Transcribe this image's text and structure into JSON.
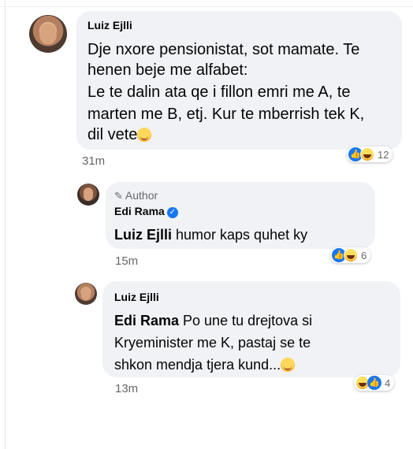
{
  "comment1": {
    "author": "Luiz Ejlli",
    "lines": [
      "Dje nxore pensionistat, sot mamate. Te",
      "henen beje me alfabet:",
      "Le te dalin ata qe i fillon emri me A, te",
      "marten me B, etj. Kur te mberrish tek K,",
      "dil vete"
    ],
    "time": "31m",
    "reaction_count": "12"
  },
  "reply1": {
    "badge": "Author",
    "author": "Edi Rama",
    "mention": "Luiz Ejlli",
    "text": " humor kaps quhet ky",
    "time": "15m",
    "reaction_count": "6"
  },
  "reply2": {
    "author": "Luiz Ejlli",
    "mention": "Edi Rama",
    "line1": " Po une tu drejtova si",
    "line2": "Kryeminister me K, pastaj se te",
    "line3": "shkon mendja tjera kund...",
    "time": "13m",
    "reaction_count": "4"
  },
  "colors": {
    "bubble": "#f0f2f5",
    "like": "#1877f2",
    "muted": "#65676b"
  },
  "icons": [
    "pencil-icon",
    "verified-badge-icon",
    "wink-emoji-icon",
    "laughing-emoji-icon",
    "like-reaction-icon",
    "haha-reaction-icon"
  ]
}
